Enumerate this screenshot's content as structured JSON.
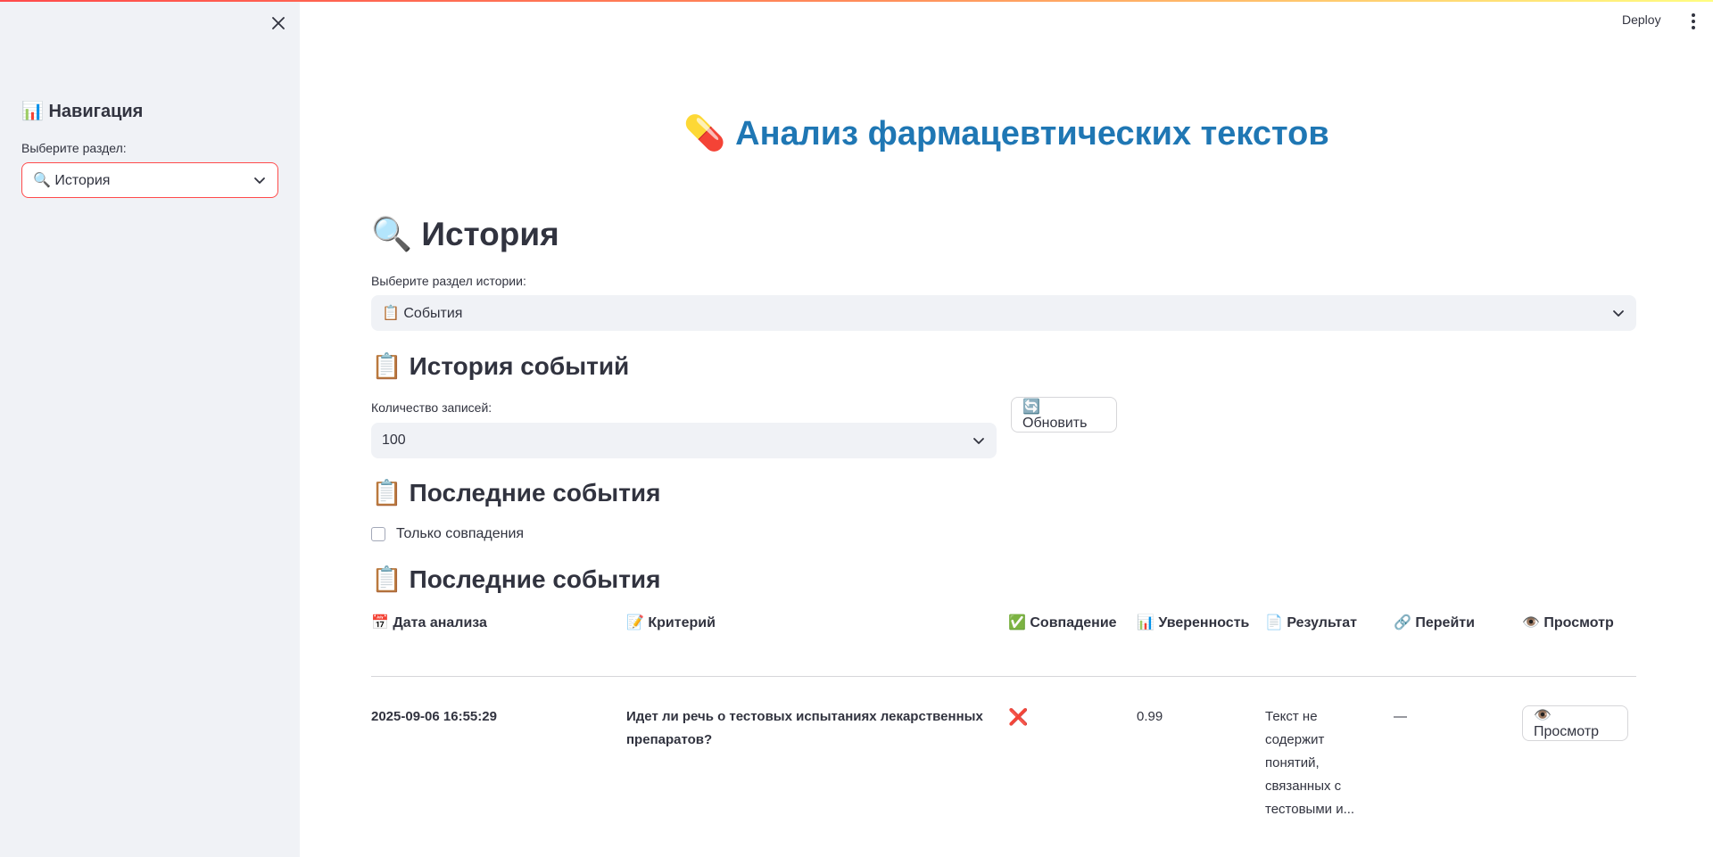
{
  "sidebar": {
    "title": "📊 Навигация",
    "select_label": "Выберите раздел:",
    "select_value": "🔍 История"
  },
  "header": {
    "deploy_label": "Deploy"
  },
  "main": {
    "app_title": "💊 Анализ фармацевтических текстов",
    "section_title": "🔍 История",
    "history_select_label": "Выберите раздел истории:",
    "history_select_value": "📋 События",
    "events_history_title": "📋 История событий",
    "records_label": "Количество записей:",
    "records_value": "100",
    "refresh_label": "🔄 Обновить",
    "recent_events_title_1": "📋 Последние события",
    "only_matches_label": "Только совпадения",
    "recent_events_title_2": "📋 Последние события"
  },
  "table": {
    "headers": {
      "date": "📅 Дата анализа",
      "criterion": "📝 Критерий",
      "match": "✅ Совпадение",
      "confidence": "📊 Уверенность",
      "result": "📄 Результат",
      "goto": "🔗 Перейти",
      "view": "👁️ Просмотр"
    },
    "rows": [
      {
        "date": "2025-09-06 16:55:29",
        "criterion": "Идет ли речь о тестовых испытаниях лекарственных препаратов?",
        "match": "❌",
        "confidence": "0.99",
        "result": "Текст не содержит понятий, связанных с тестовыми и...",
        "goto": "—",
        "view_label": "👁️ Просмотр"
      }
    ]
  },
  "colors": {
    "accent_red": "#ff4b4b",
    "title_blue": "#1f77b4",
    "sidebar_bg": "#f0f2f6"
  }
}
